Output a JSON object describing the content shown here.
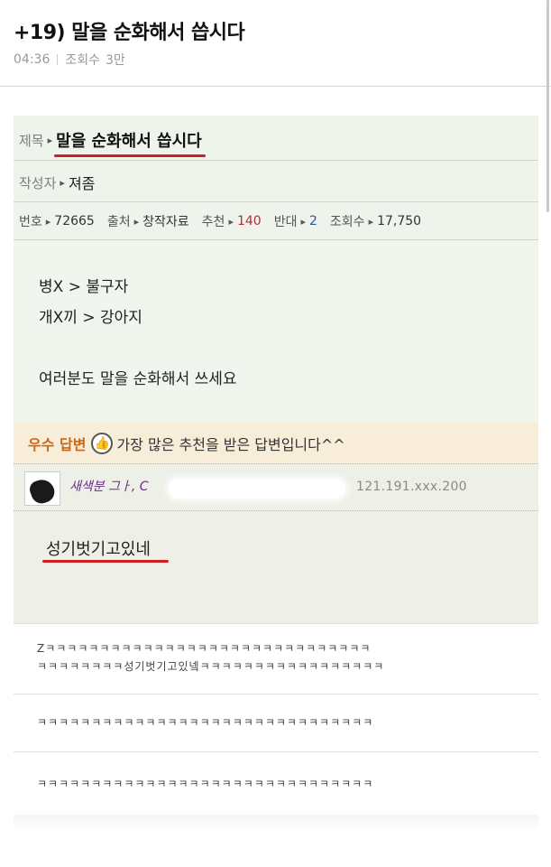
{
  "post": {
    "title": "+19) 말을 순화해서 씁시다",
    "time": "04:36",
    "views_label": "조회수",
    "views_value": "3만"
  },
  "capture": {
    "subject_label": "제목",
    "subject": "말을 순화해서 씁시다",
    "author_label": "작성자",
    "author": "져좀",
    "info": {
      "number_label": "번호",
      "number": "72665",
      "source_label": "출처",
      "source": "창작자료",
      "recommend_label": "추천",
      "recommend": "140",
      "oppose_label": "반대",
      "oppose": "2",
      "views_label": "조회수",
      "views": "17,750"
    },
    "body_lines": [
      "병X > 불구자",
      "개X끼 > 강아지",
      "여러분도 말을 순화해서 쓰세요"
    ],
    "best_answer": {
      "label": "우수 답변",
      "icon": "thumbs-up-icon",
      "description": "가장 많은 추천을 받은 답변입니다^^",
      "replier": "새색분 그ㅏ, C",
      "ip": "121.191.xxx.200",
      "reply": "성기벗기고있네"
    },
    "comments": [
      {
        "line1": "Zㅋㅋㅋㅋㅋㅋㅋㅋㅋㅋㅋㅋㅋㅋㅋㅋㅋㅋㅋㅋㅋㅋㅋㅋㅋㅋㅋㅋㅋㅋ",
        "line2": "ㅋㅋㅋㅋㅋㅋㅋㅋ성기벗기고있넼ㅋㅋㅋㅋㅋㅋㅋㅋㅋㅋㅋㅋㅋㅋㅋㅋㅋ"
      },
      {
        "line1": "ㅋㅋㅋㅋㅋㅋㅋㅋㅋㅋㅋㅋㅋㅋㅋㅋㅋㅋㅋㅋㅋㅋㅋㅋㅋㅋㅋㅋㅋㅋㅋ"
      },
      {
        "line1": "ㅋㅋㅋㅋㅋㅋㅋㅋㅋㅋㅋㅋㅋㅋㅋㅋㅋㅋㅋㅋㅋㅋㅋㅋㅋㅋㅋㅋㅋㅋㅋ"
      }
    ]
  },
  "colors": {
    "accent_red": "#cc1f1f",
    "best_label": "#c9661a",
    "capture_bg": "#eef3ec"
  }
}
